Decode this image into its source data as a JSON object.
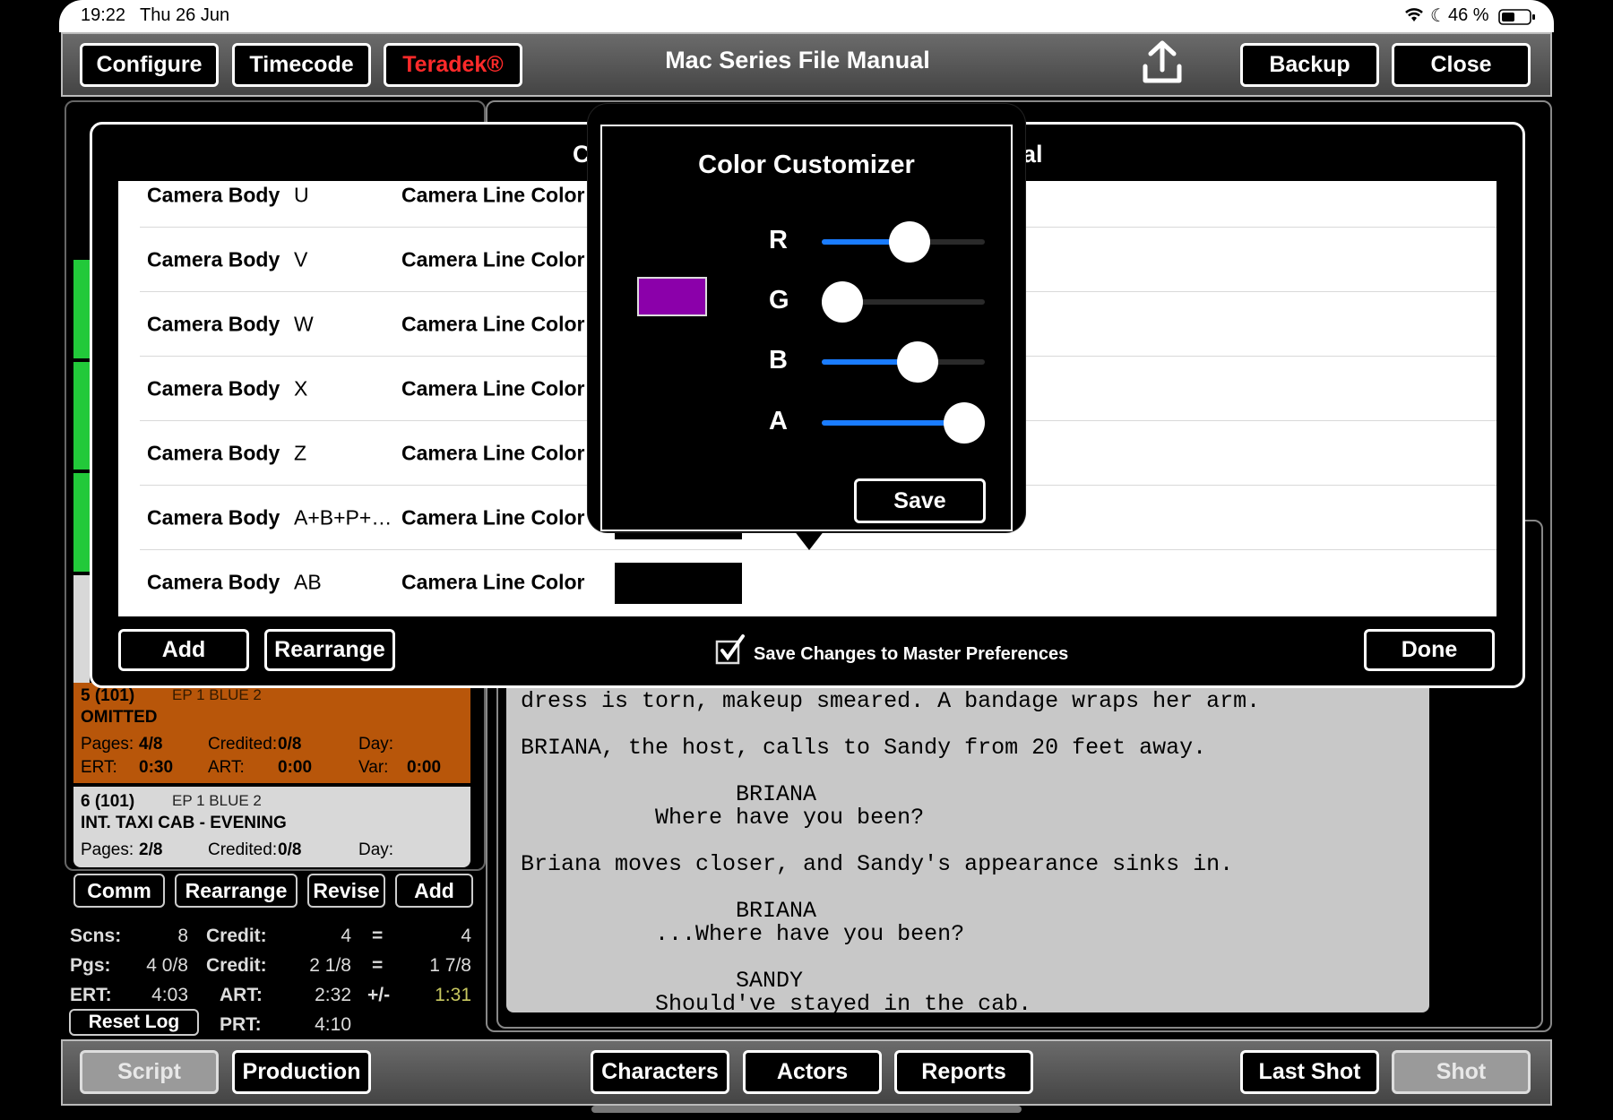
{
  "status_bar": {
    "time": "19:22",
    "date": "Thu 26 Jun",
    "battery": "46 %"
  },
  "top_toolbar": {
    "configure": "Configure",
    "timecode": "Timecode",
    "teradek": "Teradek®",
    "title": "Mac Series File Manual",
    "backup": "Backup",
    "close": "Close"
  },
  "scenes": [
    {
      "number": "5 (101)",
      "revision": "EP 1 BLUE 2",
      "heading": "OMITTED",
      "pages": "4/8",
      "credited": "0/8",
      "day_label": "Day:",
      "ert": "0:30",
      "art": "0:00",
      "var": "0:00",
      "color": "#b8560a"
    },
    {
      "number": "6 (101)",
      "revision": "EP 1 BLUE 2",
      "heading": "INT. TAXI CAB - EVENING",
      "pages": "2/8",
      "credited": "0/8",
      "day_label": "Day:",
      "color": "#d8d8d8"
    }
  ],
  "scene_labels": {
    "pages": "Pages:",
    "credited": "Credited:",
    "ert": "ERT:",
    "art": "ART:",
    "var": "Var:"
  },
  "scene_buttons": {
    "comm": "Comm",
    "rearrange": "Rearrange",
    "revise": "Revise",
    "add": "Add"
  },
  "stats": {
    "scns_label": "Scns:",
    "scns": "8",
    "credit_label": "Credit:",
    "credit1": "4",
    "eq": "=",
    "total1": "4",
    "pgs_label": "Pgs:",
    "pgs": "4 0/8",
    "credit2": "2 1/8",
    "total2": "1 7/8",
    "ert_label": "ERT:",
    "ert": "4:03",
    "art_label": "ART:",
    "art": "2:32",
    "pm": "+/-",
    "diff": "1:31",
    "reset_log": "Reset Log",
    "prt_label": "PRT:",
    "prt": "4:10"
  },
  "script_lines": [
    "dress is torn, makeup smeared. A bandage wraps her arm.",
    "BRIANA, the host, calls to Sandy from 20 feet away.",
    "                BRIANA",
    "          Where have you been?",
    "Briana moves closer, and Sandy's appearance sinks in.",
    "                BRIANA",
    "          ...Where have you been?",
    "                SANDY",
    "          Should've stayed in the cab."
  ],
  "modal": {
    "title_left": "C",
    "title_right": "al",
    "rows": [
      {
        "item": "Camera Body",
        "code": "U",
        "property": "Camera Line Color"
      },
      {
        "item": "Camera Body",
        "code": "V",
        "property": "Camera Line Color"
      },
      {
        "item": "Camera Body",
        "code": "W",
        "property": "Camera Line Color"
      },
      {
        "item": "Camera Body",
        "code": "X",
        "property": "Camera Line Color"
      },
      {
        "item": "Camera Body",
        "code": "Z",
        "property": "Camera Line Color"
      },
      {
        "item": "Camera Body",
        "code": "A+B+P+…",
        "property": "Camera Line Color"
      },
      {
        "item": "Camera Body",
        "code": "AB",
        "property": "Camera Line Color"
      }
    ],
    "add": "Add",
    "rearrange": "Rearrange",
    "save_master": "Save Changes to Master Preferences",
    "done": "Done"
  },
  "color_customizer": {
    "title": "Color Customizer",
    "preview_color": "#8b00aa",
    "sliders": [
      {
        "label": "R",
        "value": 0.55
      },
      {
        "label": "G",
        "value": 0.0
      },
      {
        "label": "B",
        "value": 0.62
      },
      {
        "label": "A",
        "value": 1.0
      }
    ],
    "save": "Save"
  },
  "bottom_toolbar": {
    "script": "Script",
    "production": "Production",
    "characters": "Characters",
    "actors": "Actors",
    "reports": "Reports",
    "last_shot": "Last Shot",
    "shot": "Shot"
  },
  "colors": {
    "accent": "#1a7cff",
    "teradek": "#ff2a2a",
    "ert_diff": "#c8c860"
  }
}
